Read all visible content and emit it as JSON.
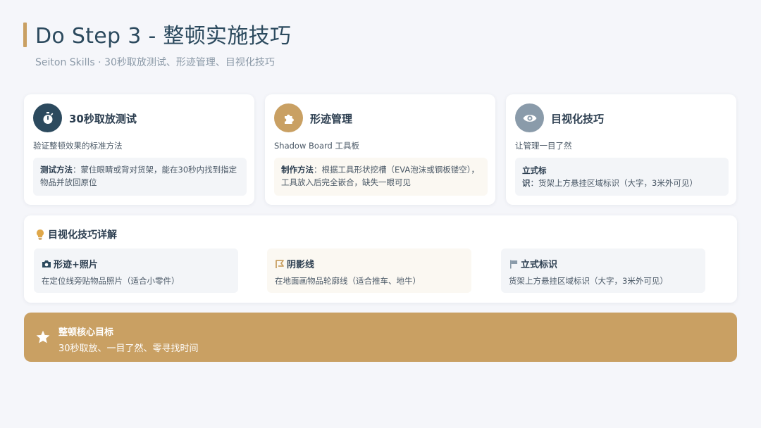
{
  "header": {
    "title": "Do Step 3 - 整顿实施技巧",
    "subtitle": "Seiton Skills · 30秒取放测试、形迹管理、目视化技巧"
  },
  "cards": [
    {
      "icon": "stopwatch-icon",
      "icon_bg": "#2c4a5e",
      "title": "30秒取放测试",
      "desc": "验证整顿效果的标准方法",
      "detail_label": "测试方法",
      "detail_text": "：蒙住眼睛或背对货架，能在30秒内找到指定物品并放回原位"
    },
    {
      "icon": "puzzle-icon",
      "icon_bg": "#c9a063",
      "title": "形迹管理",
      "desc": "Shadow Board 工具板",
      "detail_label": "制作方法",
      "detail_text": "：根据工具形状挖槽（EVA泡沫或钢板镂空），工具放入后完全嵌合，缺失一眼可见"
    },
    {
      "icon": "eye-icon",
      "icon_bg": "#8a9baa",
      "title": "目视化技巧",
      "desc": "让管理一目了然",
      "detail_label": "立式标识",
      "detail_text": "：货架上方悬挂区域标识（大字，3米外可见）"
    }
  ],
  "details": {
    "title": "目视化技巧详解",
    "icon": "lightbulb-icon",
    "items": [
      {
        "icon": "camera-icon",
        "title": "形迹+照片",
        "desc": "在定位线旁贴物品照片（适合小零件）"
      },
      {
        "icon": "border-corner-icon",
        "title": "阴影线",
        "desc": "在地面画物品轮廓线（适合推车、地牛）"
      },
      {
        "icon": "sign-icon",
        "title": "立式标识",
        "desc": "货架上方悬挂区域标识（大字，3米外可见）"
      }
    ]
  },
  "goal": {
    "icon": "star-icon",
    "title": "整顿核心目标",
    "text": "30秒取放、一目了然、零寻找时间"
  },
  "colors": {
    "accent": "#c9a063",
    "primary": "#2c4a5e",
    "background": "#f5f6fa"
  }
}
